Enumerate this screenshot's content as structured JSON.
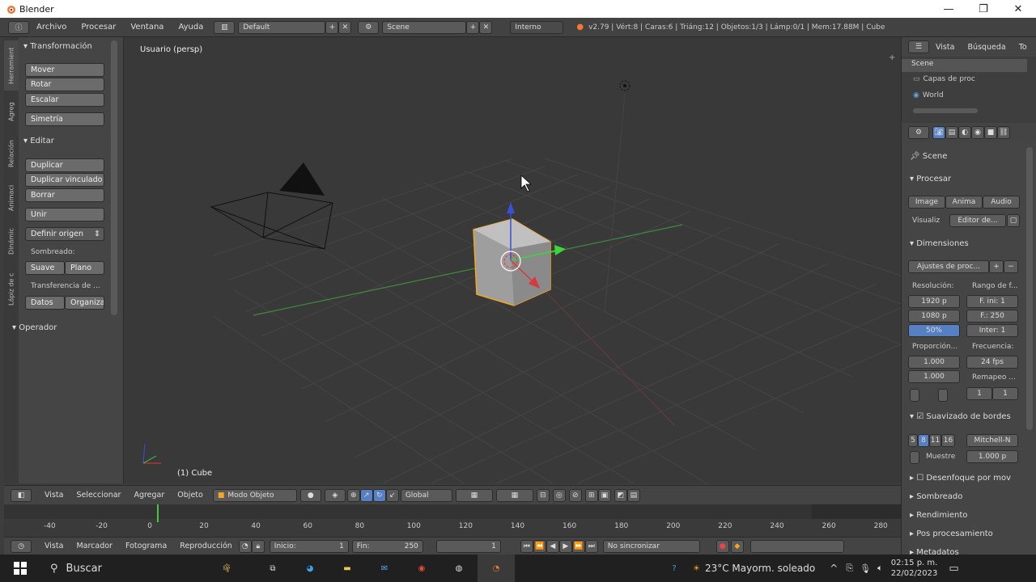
{
  "window": {
    "title": "Blender",
    "minimize": "—",
    "maximize": "❐",
    "close": "✕"
  },
  "infobar": {
    "menus": [
      "Archivo",
      "Procesar",
      "Ventana",
      "Ayuda"
    ],
    "screen_layout": "Default",
    "scene": "Scene",
    "render_engine": "Interno",
    "stats": "v2.79 | Vért:8 | Caras:6 | Triáng:12 | Objetos:1/3 | Lámp:0/1 | Mem:17.88M | Cube"
  },
  "toolshelf": {
    "tabs": [
      "Herramient",
      "Agreg",
      "Relación",
      "Animaci",
      "Dinámic",
      "Lápiz de c"
    ],
    "transform_header": "Transformación",
    "transform_buttons": [
      "Mover",
      "Rotar",
      "Escalar"
    ],
    "mirror": "Simetría",
    "edit_header": "Editar",
    "edit_buttons": [
      "Duplicar",
      "Duplicar vinculado",
      "Borrar"
    ],
    "join": "Unir",
    "set_origin": "Definir origen",
    "shading_label": "Sombreado:",
    "smooth": "Suave",
    "flat": "Plano",
    "data_transfer_label": "Transferencia de ...",
    "data": "Datos",
    "organize": "Organiza",
    "operator_header": "Operador"
  },
  "viewport": {
    "view_name": "Usuario (persp)",
    "object_name": "(1) Cube"
  },
  "view_header": {
    "menus": [
      "Vista",
      "Seleccionar",
      "Agregar",
      "Objeto"
    ],
    "mode": "Modo Objeto",
    "orientation": "Global"
  },
  "timeline": {
    "ticks": [
      "-40",
      "-20",
      "0",
      "20",
      "40",
      "60",
      "80",
      "100",
      "120",
      "140",
      "160",
      "180",
      "200",
      "220",
      "240",
      "260",
      "280"
    ],
    "menus": [
      "Vista",
      "Marcador",
      "Fotograma",
      "Reproducción"
    ],
    "start_label": "Inicio:",
    "start_value": "1",
    "end_label": "Fin:",
    "end_value": "250",
    "current_frame": "1",
    "sync": "No sincronizar"
  },
  "outliner": {
    "tabs": [
      "Vista",
      "Búsqueda",
      "To"
    ],
    "items": [
      "Scene",
      "Capas de proc",
      "World"
    ]
  },
  "properties": {
    "context": "Scene",
    "render_header": "Procesar",
    "render_buttons": [
      "Image",
      "Anima",
      "Audio"
    ],
    "display_label": "Visualiz",
    "display_value": "Editor de...",
    "dimensions_header": "Dimensiones",
    "presets": "Ajustes de proc...",
    "resolution_label": "Resolución:",
    "res_x": "1920 p",
    "res_y": "1080 p",
    "res_pct": "50%",
    "frame_range_label": "Rango de f...",
    "frame_start": "F. ini: 1",
    "frame_end": "F.: 250",
    "frame_step": "Inter: 1",
    "aspect_label": "Proporción...",
    "aspect_x": "1.000",
    "aspect_y": "1.000",
    "framerate_label": "Frecuencia:",
    "framerate": "24 fps",
    "remap_label": "Remapeo ...",
    "remap_old": "1",
    "remap_new": "1",
    "aa_header": "Suavizado de bordes",
    "aa_samples": [
      "5",
      "8",
      "11",
      "16"
    ],
    "aa_filter": "Mitchell-N",
    "full_sample": "Muestre",
    "filter_size": "1.000 p",
    "motion_blur": "Desenfoque por mov",
    "shading": "Sombreado",
    "performance": "Rendimiento",
    "post_processing": "Pos procesamiento",
    "metadata": "Metadatos"
  },
  "taskbar": {
    "search": "Buscar",
    "weather": "23°C  Mayorm. soleado",
    "time": "02:15 p. m.",
    "date": "22/02/2023"
  },
  "colors": {
    "accent": "#f5792a",
    "axis_x": "#c33b3b",
    "axis_y": "#4aa84a",
    "selection": "#f5a623"
  }
}
